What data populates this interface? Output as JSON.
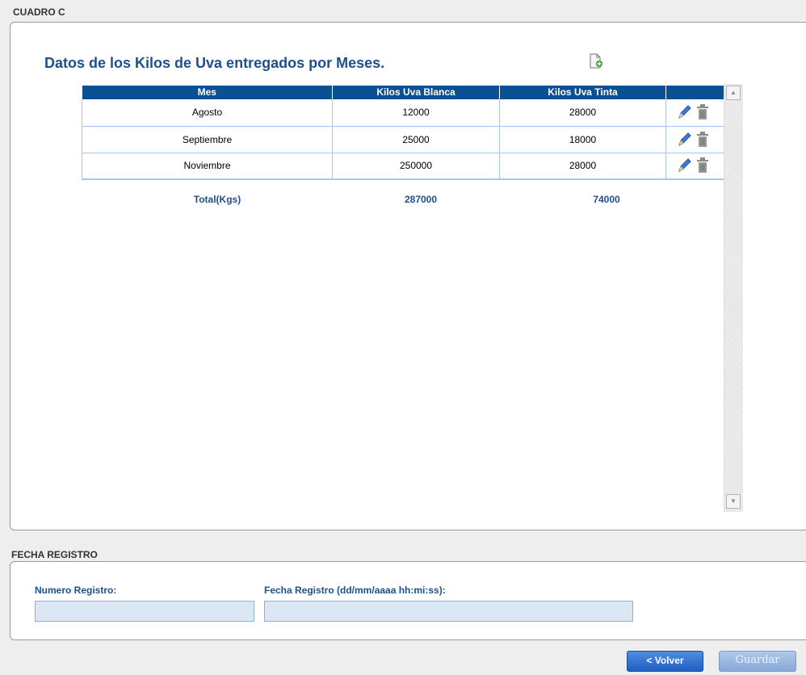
{
  "cuadro": {
    "section_title": "CUADRO C",
    "data_title": "Datos de los Kilos de Uva entregados por Meses.",
    "table": {
      "headers": [
        "Mes",
        "Kilos Uva Blanca",
        "Kilos Uva Tinta",
        ""
      ],
      "rows": [
        {
          "mes": "Agosto",
          "blanca": "12000",
          "tinta": "28000"
        },
        {
          "mes": "Septiembre",
          "blanca": "25000",
          "tinta": "18000"
        },
        {
          "mes": "Noviembre",
          "blanca": "250000",
          "tinta": "28000"
        }
      ]
    },
    "totals": {
      "label": "Total(Kgs)",
      "blanca": "287000",
      "tinta": "74000"
    }
  },
  "fecha": {
    "section_title": "FECHA REGISTRO",
    "numero_label": "Numero Registro:",
    "numero_value": "",
    "fecha_label": "Fecha Registro (dd/mm/aaaa hh:mi:ss):",
    "fecha_value": ""
  },
  "buttons": {
    "volver": "< Volver",
    "guardar": "Guardar"
  },
  "icons": {
    "add": "add-document-icon",
    "edit": "pencil-icon",
    "delete": "trash-icon"
  },
  "colors": {
    "header_bg": "#0b4f95",
    "title": "#1f4f8c",
    "input_bg": "#dce7f4"
  }
}
